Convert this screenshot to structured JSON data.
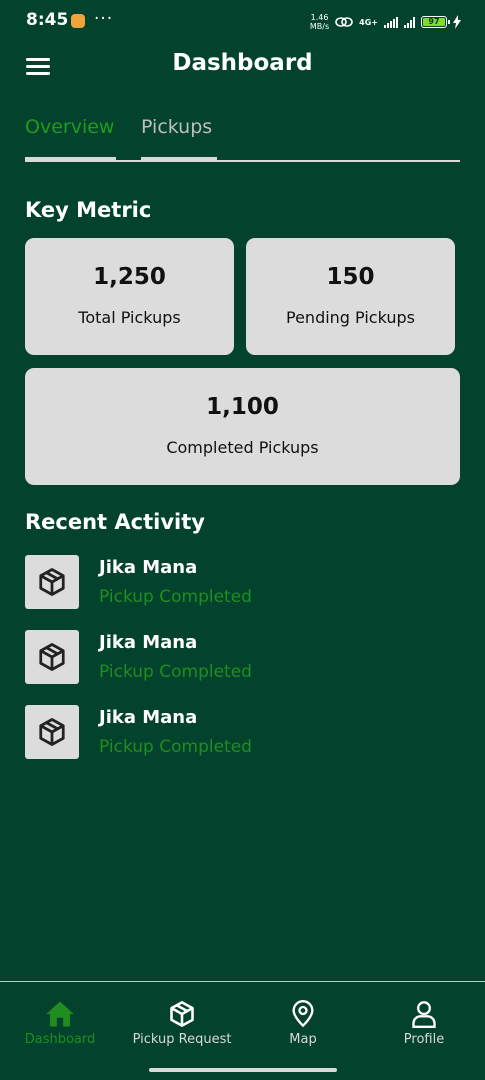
{
  "status_bar": {
    "time": "8:45",
    "dots": "···",
    "speed_top": "1.46",
    "speed_unit": "MB/s",
    "network": "4G+",
    "battery": "97"
  },
  "header": {
    "title": "Dashboard",
    "menu_icon": "hamburger-menu-icon"
  },
  "tabs": [
    {
      "label": "Overview",
      "active": true
    },
    {
      "label": "Pickups",
      "active": false
    }
  ],
  "metrics": {
    "section_title": "Key Metric",
    "cards": [
      {
        "value": "1,250",
        "label": "Total Pickups"
      },
      {
        "value": "150",
        "label": "Pending Pickups"
      },
      {
        "value": "1,100",
        "label": "Completed Pickups"
      }
    ]
  },
  "activity": {
    "section_title": "Recent Activity",
    "items": [
      {
        "name": "Jika Mana",
        "status": "Pickup Completed",
        "icon": "package-box-icon"
      },
      {
        "name": "Jika Mana",
        "status": "Pickup Completed",
        "icon": "package-box-icon"
      },
      {
        "name": "Jika Mana",
        "status": "Pickup Completed",
        "icon": "package-box-icon"
      }
    ]
  },
  "bottom_nav": [
    {
      "label": "Dashboard",
      "icon": "home-icon",
      "active": true
    },
    {
      "label": "Pickup Request",
      "icon": "package-box-icon",
      "active": false
    },
    {
      "label": "Map",
      "icon": "map-pin-icon",
      "active": false
    },
    {
      "label": "Profile",
      "icon": "user-icon",
      "active": false
    }
  ],
  "colors": {
    "background": "#03432e",
    "accent_green": "#1f9b1f",
    "card": "#dcdcdc"
  }
}
